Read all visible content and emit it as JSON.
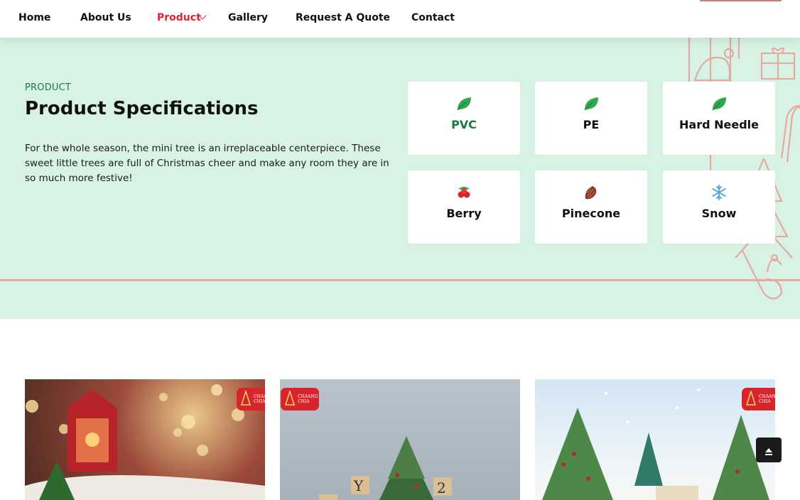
{
  "nav": {
    "items": [
      {
        "label": "Home"
      },
      {
        "label": "About Us"
      },
      {
        "label": "Product",
        "active": true
      },
      {
        "label": "Gallery"
      },
      {
        "label": "Request A Quote"
      },
      {
        "label": "Contact"
      }
    ],
    "icons": {
      "dropdown": "chevron-down-icon"
    }
  },
  "spec": {
    "eyebrow": "PRODUCT",
    "title": "Product Specifications",
    "description": "For the whole season, the mini tree is an irreplaceable centerpiece. These sweet little trees are full of Christmas cheer and make any room they are in so much more festive!",
    "cards": [
      {
        "label": "PVC",
        "icon": "leaf-icon",
        "highlight": true
      },
      {
        "label": "PE",
        "icon": "leaf-icon"
      },
      {
        "label": "Hard Needle",
        "icon": "leaf-icon"
      },
      {
        "label": "Berry",
        "icon": "berry-icon"
      },
      {
        "label": "Pinecone",
        "icon": "pinecone-icon"
      },
      {
        "label": "Snow",
        "icon": "snowflake-icon"
      }
    ]
  },
  "gallery": {
    "badge_text": [
      "CHAANG",
      "CHIA"
    ]
  },
  "colors": {
    "accent_red": "#e0242d",
    "brand_green": "#177a3c",
    "section_bg": "#d8f3e4",
    "deco_pink": "#e3a9a2"
  }
}
